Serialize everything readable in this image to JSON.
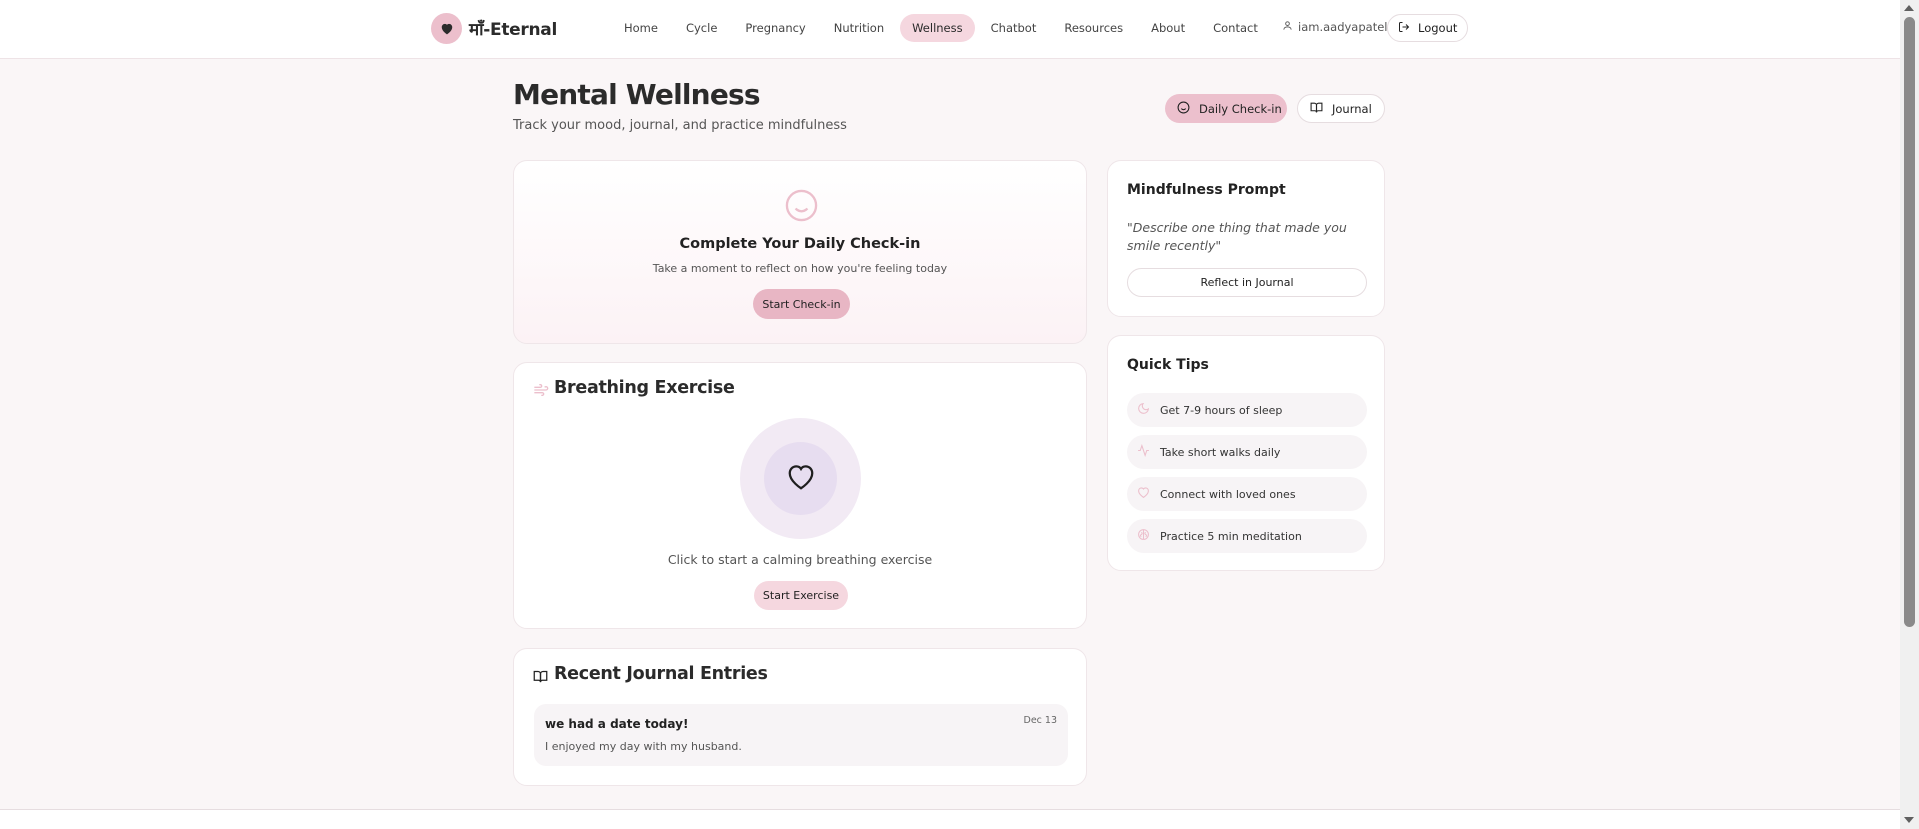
{
  "app": {
    "brand": "माँ-Eternal"
  },
  "nav": {
    "items": [
      "Home",
      "Cycle",
      "Pregnancy",
      "Nutrition",
      "Wellness",
      "Chatbot",
      "Resources",
      "About",
      "Contact"
    ],
    "active": "Wellness"
  },
  "user": {
    "username": "iam.aadyapatel",
    "logout_label": "Logout"
  },
  "page": {
    "title": "Mental Wellness",
    "subtitle": "Track your mood, journal, and practice mindfulness",
    "daily_checkin_label": "Daily Check-in",
    "journal_label": "Journal"
  },
  "checkin": {
    "title": "Complete Your Daily Check-in",
    "subtitle": "Take a moment to reflect on how you're feeling today",
    "button": "Start Check-in"
  },
  "breathing": {
    "title": "Breathing Exercise",
    "hint": "Click to start a calming breathing exercise",
    "button": "Start Exercise"
  },
  "journal": {
    "title": "Recent Journal Entries",
    "entries": [
      {
        "title": "we had a date today!",
        "body": "I enjoyed my day with my husband.",
        "date": "Dec 13"
      }
    ]
  },
  "mindfulness": {
    "title": "Mindfulness Prompt",
    "prompt": "\"Describe one thing that made you smile recently\"",
    "button": "Reflect in Journal"
  },
  "tips": {
    "title": "Quick Tips",
    "items": [
      {
        "icon": "moon-icon",
        "label": "Get 7-9 hours of sleep"
      },
      {
        "icon": "activity-icon",
        "label": "Take short walks daily"
      },
      {
        "icon": "heart-icon",
        "label": "Connect with loved ones"
      },
      {
        "icon": "brain-icon",
        "label": "Practice 5 min meditation"
      }
    ]
  },
  "colors": {
    "accent": "#ecc0cd",
    "accent_light": "#f5d7df",
    "background": "#faf6f7",
    "breath_ring": "#e7ddf0"
  }
}
